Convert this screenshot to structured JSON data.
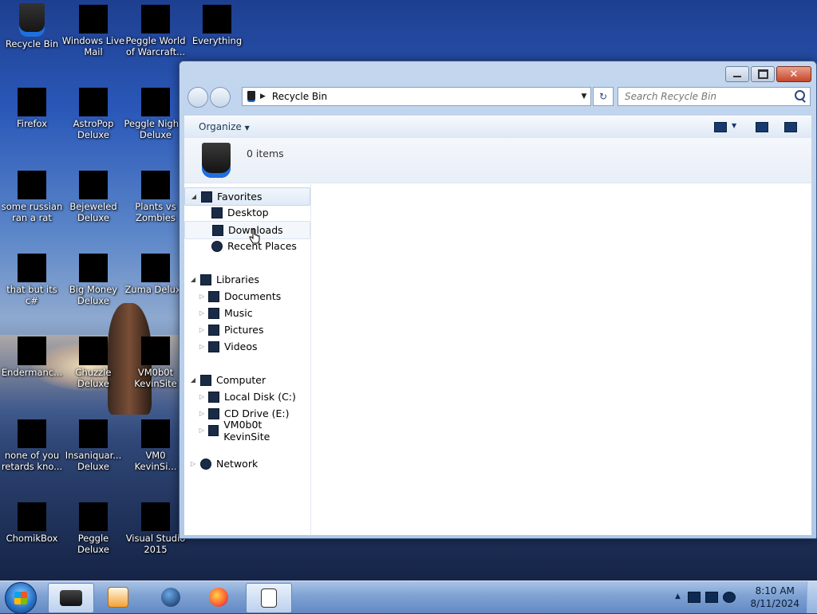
{
  "desktop": {
    "icons": [
      {
        "label": "Recycle Bin"
      },
      {
        "label": "Windows Live Mail"
      },
      {
        "label": "Peggle World of Warcraft..."
      },
      {
        "label": "Everything"
      },
      {
        "label": "Firefox"
      },
      {
        "label": "AstroPop Deluxe"
      },
      {
        "label": "Peggle Nights Deluxe"
      },
      {
        "label": "some russian ran a rat"
      },
      {
        "label": "Bejeweled Deluxe"
      },
      {
        "label": "Plants vs Zombies"
      },
      {
        "label": "that but its c#"
      },
      {
        "label": "Big Money Deluxe"
      },
      {
        "label": "Zuma Deluxe"
      },
      {
        "label": "Endermanc..."
      },
      {
        "label": "Chuzzle Deluxe"
      },
      {
        "label": "VM0b0t KevinSite"
      },
      {
        "label": "none of you retards kno..."
      },
      {
        "label": "Insaniquar... Deluxe"
      },
      {
        "label": "VM0 KevinSi..."
      },
      {
        "label": "ChomikBox"
      },
      {
        "label": "Peggle Deluxe"
      },
      {
        "label": "Visual Studio 2015"
      }
    ]
  },
  "explorer": {
    "address": "Recycle Bin",
    "search_placeholder": "Search Recycle Bin",
    "toolbar": {
      "organize": "Organize"
    },
    "info": {
      "items": "0 items"
    },
    "nav": {
      "favorites": "Favorites",
      "desktop": "Desktop",
      "downloads": "Downloads",
      "recent": "Recent Places",
      "libraries": "Libraries",
      "documents": "Documents",
      "music": "Music",
      "pictures": "Pictures",
      "videos": "Videos",
      "computer": "Computer",
      "local_disk": "Local Disk (C:)",
      "cd_drive": "CD Drive (E:)",
      "vm_site": "VM0b0t KevinSite",
      "network": "Network"
    }
  },
  "taskbar": {
    "time": "8:10 AM",
    "date": "8/11/2024"
  },
  "colors": {
    "accent_blue": "#1f6fe0",
    "close_red": "#c7452b"
  }
}
